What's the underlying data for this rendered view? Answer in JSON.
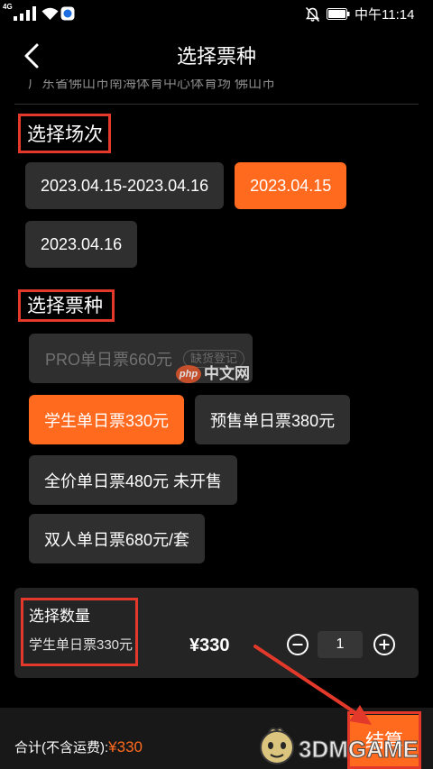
{
  "colors": {
    "background": "#000000",
    "surface": "#2f2f2f",
    "panel": "#242424",
    "footer": "#181818",
    "accent": "#ff6a1f",
    "annotation": "#e3392a",
    "muted_text": "#717171"
  },
  "status_bar": {
    "network": "4G",
    "time": "中午11:14",
    "icons": [
      "signal-icon",
      "wifi-icon",
      "app-notification-icon",
      "mute-icon",
      "battery-icon"
    ]
  },
  "header": {
    "title": "选择票种",
    "back_icon": "chevron-left-icon"
  },
  "venue": {
    "address": "广东省佛山市南海体育中心体育场 佛山市"
  },
  "sessions": {
    "title": "选择场次",
    "items": [
      {
        "label": "2023.04.15-2023.04.16",
        "selected": false
      },
      {
        "label": "2023.04.15",
        "selected": true
      },
      {
        "label": "2023.04.16",
        "selected": false
      }
    ]
  },
  "tickets": {
    "title": "选择票种",
    "items": [
      {
        "label": "PRO单日票660元",
        "badge": "缺货登记",
        "selected": false,
        "disabled": true
      },
      {
        "label": "学生单日票330元",
        "selected": true,
        "disabled": false
      },
      {
        "label": "预售单日票380元",
        "selected": false,
        "disabled": false
      },
      {
        "label": "全价单日票480元 未开售",
        "selected": false,
        "disabled": false
      },
      {
        "label": "双人单日票680元/套",
        "selected": false,
        "disabled": false
      }
    ]
  },
  "quantity": {
    "title": "选择数量",
    "ticket_name": "学生单日票330元",
    "price": "¥330",
    "value": "1",
    "decrement_icon": "minus-circle-icon",
    "increment_icon": "plus-circle-icon"
  },
  "footer": {
    "total_label": "合计(不含运费):",
    "total_value": "¥330",
    "checkout_label": "结算"
  },
  "watermarks": {
    "php_logo": "php",
    "php_text": "中文网",
    "game_text": "3DMGAME"
  }
}
